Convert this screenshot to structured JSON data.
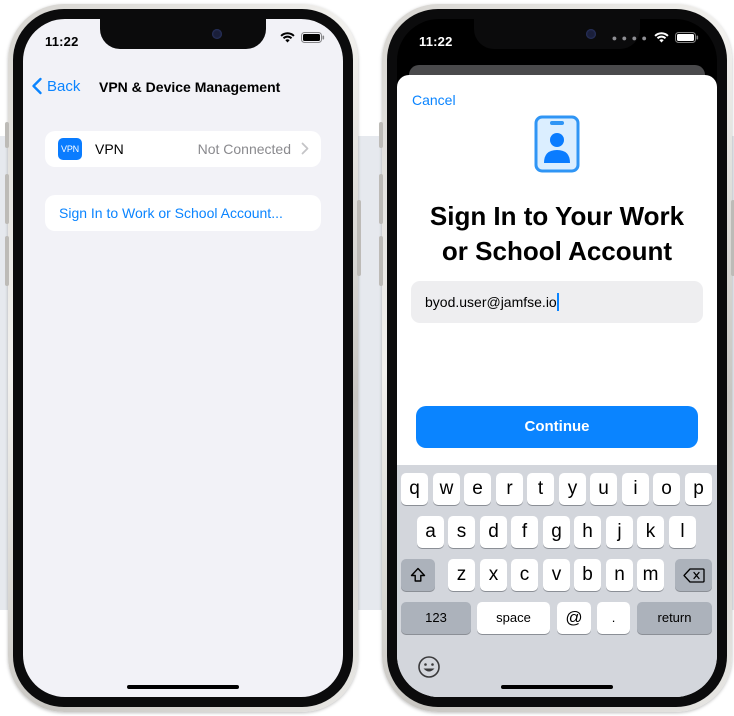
{
  "status_bar": {
    "time": "11:22"
  },
  "left_screen": {
    "nav": {
      "back_label": "Back",
      "title": "VPN & Device Management"
    },
    "vpn_row": {
      "icon_text": "VPN",
      "label": "VPN",
      "status": "Not Connected"
    },
    "signin_link": "Sign In to Work or School Account..."
  },
  "right_screen": {
    "cancel_label": "Cancel",
    "title_line1": "Sign In to Your Work",
    "title_line2": "or School Account",
    "email_value": "byod.user@jamfse.io",
    "continue_label": "Continue",
    "keyboard": {
      "row1": [
        "q",
        "w",
        "e",
        "r",
        "t",
        "y",
        "u",
        "i",
        "o",
        "p"
      ],
      "row2": [
        "a",
        "s",
        "d",
        "f",
        "g",
        "h",
        "j",
        "k",
        "l"
      ],
      "row3": [
        "z",
        "x",
        "c",
        "v",
        "b",
        "n",
        "m"
      ],
      "numbers_label": "123",
      "space_label": "space",
      "at_label": "@",
      "dot_label": ".",
      "return_label": "return"
    }
  },
  "colors": {
    "accent": "#0a84ff",
    "grouped_bg": "#f2f2f7",
    "keyboard_bg": "#d3d6dc",
    "secondary_text": "#8a8a8e"
  }
}
